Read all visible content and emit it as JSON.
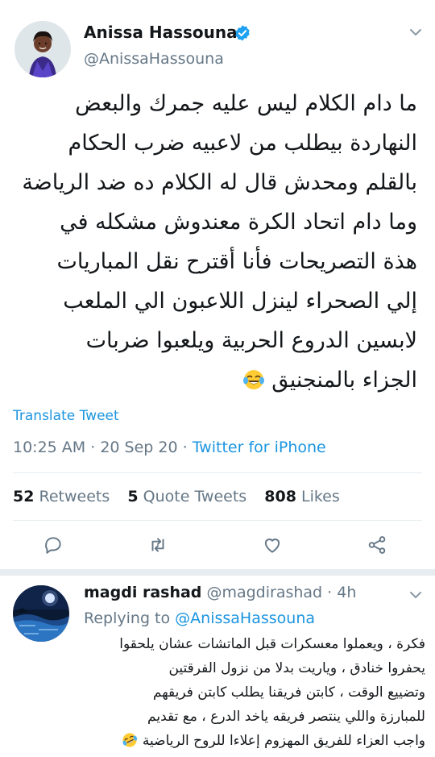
{
  "tweet": {
    "author_name": "Anissa Hassouna",
    "author_handle": "@AnissaHassouna",
    "body_lines": [
      "ما دام الكلام ليس عليه جمرك والبعض",
      "النهاردة بيطلب من لاعبيه ضرب الحكام",
      "بالقلم ومحدش قال له الكلام ده ضد الرياضة",
      "وما دام اتحاد الكرة معندوش مشكله في",
      "هذة التصريحات فأنا أقترح نقل المباريات",
      "إلي الصحراء لينزل اللاعبون الي الملعب",
      "لابسين الدروع الحربية ويلعبوا ضربات",
      "الجزاء بالمنجنيق"
    ],
    "body_emoji": "face-with-tears-of-joy",
    "translate_label": "Translate Tweet",
    "time": "10:25 AM",
    "date": "20 Sep 20",
    "source": "Twitter for iPhone",
    "separator": "·"
  },
  "stats": {
    "retweets_count": "52",
    "retweets_label": "Retweets",
    "quotes_count": "5",
    "quotes_label": "Quote Tweets",
    "likes_count": "808",
    "likes_label": "Likes"
  },
  "actions": [
    {
      "icon": "reply-icon"
    },
    {
      "icon": "retweet-icon"
    },
    {
      "icon": "like-icon"
    },
    {
      "icon": "share-icon"
    }
  ],
  "reply": {
    "name": "magdi rashad",
    "handle": "@magdirashad",
    "separator": "·",
    "age": "4h",
    "replying_label": "Replying to",
    "replying_to": "@AnissaHassouna",
    "body_lines": [
      "فكرة ، ويعملوا معسكرات قبل الماتشات عشان يلحقوا",
      "يحفروا خنادق ، وياريت بدلا من نزول الفرقتين",
      "وتضييع الوقت ، كابتن فريقنا يطلب كابتن فريقهم",
      "للمبارزة واللي ينتصر فريقه ياخد الدرع ، مع تقديم",
      "واجب العزاء للفريق المهزوم إعلاءا للروح الرياضية"
    ],
    "body_emoji": "rolling-on-the-floor-laughing"
  },
  "colors": {
    "link": "#1b95e0",
    "verified": "#1da1f2",
    "muted": "#657786",
    "text": "#14171a",
    "divider": "#e6ecf0"
  }
}
